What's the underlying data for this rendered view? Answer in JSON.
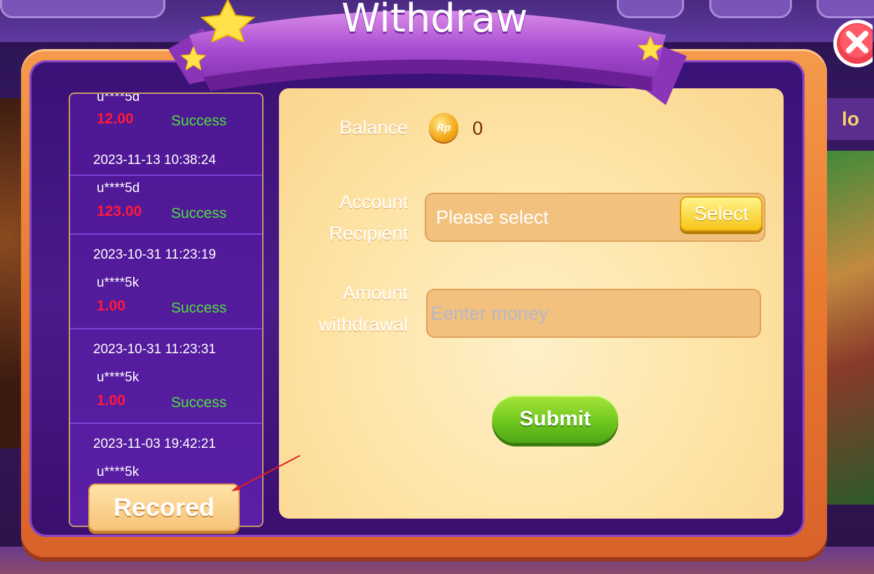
{
  "dialog": {
    "title": "Withdraw",
    "close_icon": "close-icon"
  },
  "colors": {
    "frame_orange": "#e8792e",
    "panel_purple": "#4a1b8a",
    "form_cream": "#fde2a2",
    "amount_red": "#ff1a3a",
    "status_green": "#4de03a",
    "submit_green": "#6cc41c"
  },
  "records": {
    "items": [
      {
        "date": "",
        "user": "u****5d",
        "amount": "12.00",
        "status": "Success"
      },
      {
        "date": "2023-11-13 10:38:24",
        "user": "u****5d",
        "amount": "123.00",
        "status": "Success"
      },
      {
        "date": "2023-10-31 11:23:19",
        "user": "u****5k",
        "amount": "1.00",
        "status": "Success"
      },
      {
        "date": "2023-10-31 11:23:31",
        "user": "u****5k",
        "amount": "1.00",
        "status": "Success"
      },
      {
        "date": "2023-11-03 19:42:21",
        "user": "u****5k",
        "amount": "",
        "status": ""
      }
    ],
    "button_label": "Recored"
  },
  "form": {
    "balance_label": "Balance",
    "coin_icon_label": "Rp",
    "balance_value": "0",
    "account_label_line1": "Account",
    "account_label_line2": "Recipient",
    "account_placeholder": "Please select",
    "select_button": "Select",
    "amount_label_line1": "Amount",
    "amount_label_line2": "withdrawal",
    "amount_placeholder": "Eenter money",
    "submit_button": "Submit"
  },
  "background": {
    "right_badge": "lo"
  }
}
